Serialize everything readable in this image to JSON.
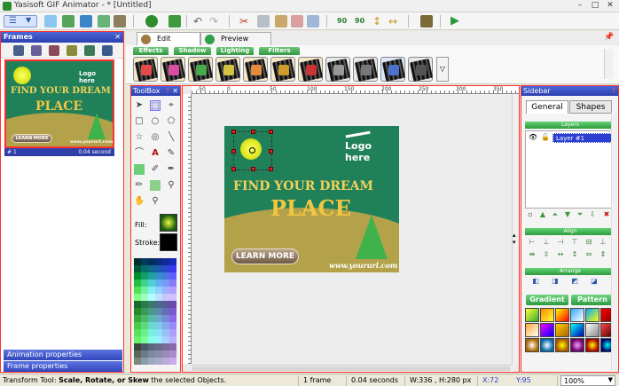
{
  "window": {
    "title": "Yasisoft GIF Animator - * [Untitled]",
    "controls": [
      "–",
      "□",
      "✕"
    ]
  },
  "frames_panel": {
    "title": "Frames",
    "frame_label": "# 1",
    "frame_duration": "0.04 second",
    "buttons": [
      "Animation properties",
      "Frame properties"
    ]
  },
  "tabs": {
    "edit": "Edit",
    "preview": "Preview"
  },
  "effect_tabs": [
    "Effects",
    "Shadow",
    "Lighting",
    "Filters"
  ],
  "toolbox": {
    "title": "ToolBox",
    "fill_label": "Fill:",
    "stroke_label": "Stroke:"
  },
  "banner": {
    "logo": "Logo here",
    "line1": "FIND YOUR DREAM",
    "line2": "PLACE",
    "button": "LEARN MORE",
    "url": "www.yoururl.com"
  },
  "thumb_banner": {
    "logo": "Logo here",
    "line1": "FIND YOUR DREAM",
    "line2": "PLACE",
    "button": "LEARN MORE",
    "url": "www.yoururl.com"
  },
  "ruler": [
    "-50",
    "0",
    "50",
    "100",
    "150",
    "200",
    "250",
    "300",
    "350"
  ],
  "sidebar": {
    "title": "Sidebar",
    "tabs": [
      "General",
      "Shapes"
    ],
    "layers_title": "Layers",
    "layer_name": "Layer #1",
    "align_title": "Align",
    "arrange_title": "Arrange",
    "gradient_btn": "Gradient",
    "pattern_btn": "Pattern"
  },
  "status": {
    "tool_prefix": "Transform Tool: ",
    "tool_bold": "Scale, Rotate, or Skew",
    "tool_suffix": " the selected Objects.",
    "frames": "1 frame",
    "seconds": "0.04 seconds",
    "size": "W:336 , H:280 px",
    "x": "X:72",
    "y": "Y:95",
    "zoom": "100%"
  },
  "colors": {
    "accent": "#2b3fb0",
    "highlight_border": "#ff3030",
    "banner_bg": "#20805a",
    "headline": "#f2d25a"
  }
}
